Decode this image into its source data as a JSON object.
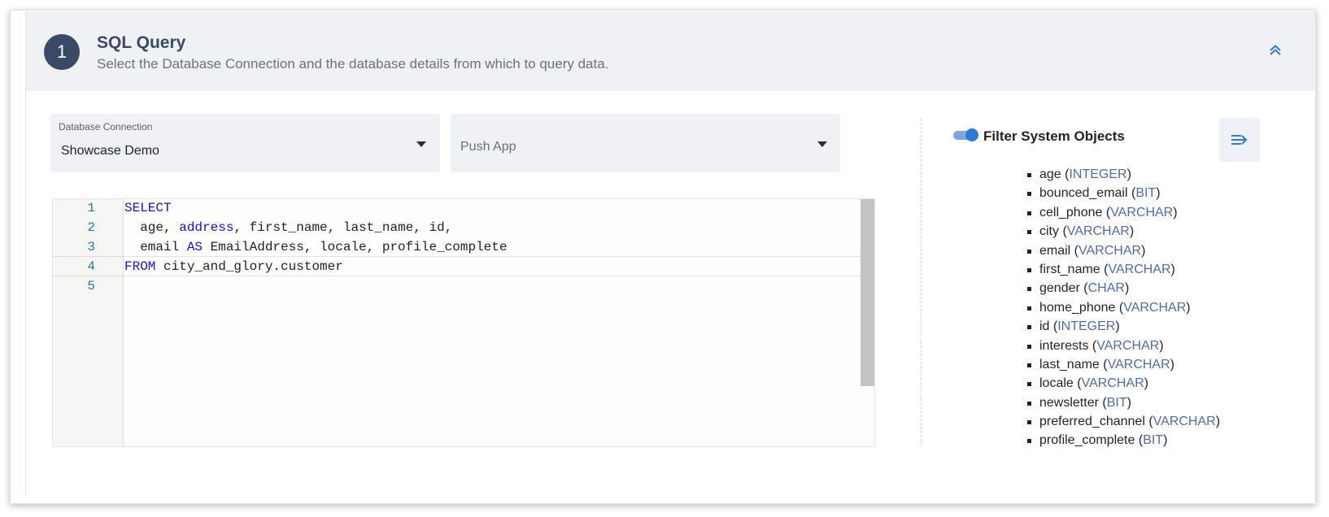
{
  "section": {
    "step_number": "1",
    "title": "SQL Query",
    "subtitle": "Select the Database Connection and the database details from which to query data."
  },
  "connection_select": {
    "label": "Database Connection",
    "value": "Showcase Demo"
  },
  "app_select": {
    "placeholder": "Push App"
  },
  "editor": {
    "line_numbers": [
      "1",
      "2",
      "3",
      "4",
      "5"
    ],
    "lines": {
      "l1_kw": "SELECT",
      "l2_a": "  age, ",
      "l2_kw": "address",
      "l2_b": ", first_name, last_name, id,",
      "l3_a": "  email ",
      "l3_kw": "AS",
      "l3_b": " EmailAddress, locale, profile_complete",
      "l4_kw": "FROM",
      "l4_b": " city_and_glory.customer",
      "l5": ""
    }
  },
  "filter_toggle": {
    "label": "Filter System Objects",
    "checked": true
  },
  "fields": [
    {
      "name": "age",
      "type": "INTEGER"
    },
    {
      "name": "bounced_email",
      "type": "BIT"
    },
    {
      "name": "cell_phone",
      "type": "VARCHAR"
    },
    {
      "name": "city",
      "type": "VARCHAR"
    },
    {
      "name": "email",
      "type": "VARCHAR"
    },
    {
      "name": "first_name",
      "type": "VARCHAR"
    },
    {
      "name": "gender",
      "type": "CHAR"
    },
    {
      "name": "home_phone",
      "type": "VARCHAR"
    },
    {
      "name": "id",
      "type": "INTEGER"
    },
    {
      "name": "interests",
      "type": "VARCHAR"
    },
    {
      "name": "last_name",
      "type": "VARCHAR"
    },
    {
      "name": "locale",
      "type": "VARCHAR"
    },
    {
      "name": "newsletter",
      "type": "BIT"
    },
    {
      "name": "preferred_channel",
      "type": "VARCHAR"
    },
    {
      "name": "profile_complete",
      "type": "BIT"
    }
  ],
  "colors": {
    "header_bg": "#eff1f4",
    "badge": "#3a4a66",
    "accent": "#2f7ad8",
    "keyword": "#1414d0",
    "type": "#4f6ca8"
  }
}
